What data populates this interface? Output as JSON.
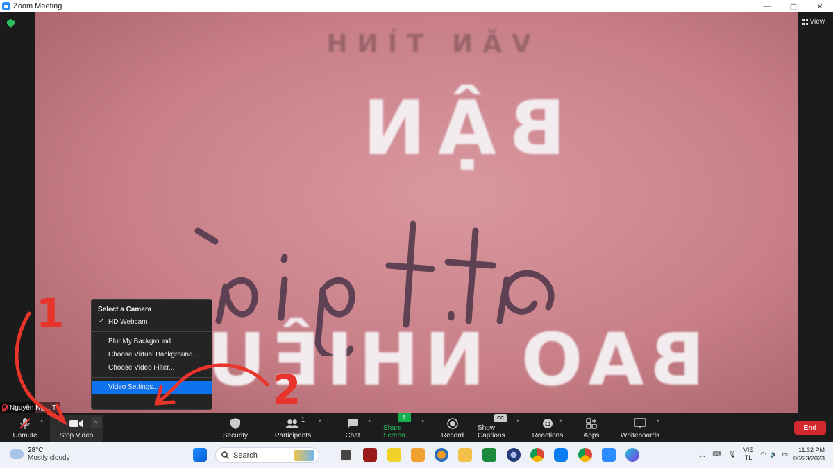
{
  "window": {
    "title": "Zoom Meeting",
    "controls": [
      "—",
      "▢",
      "✕"
    ]
  },
  "top_right": {
    "view_label": "View"
  },
  "video": {
    "top_text": "VĂN TÌNH",
    "line1": "BẬN",
    "script": "tất giá",
    "line3": "BAO NHIÊU"
  },
  "participant": {
    "name": "Nguyễn Ng... T"
  },
  "camera_menu": {
    "header": "Select a Camera",
    "camera": "HD Webcam",
    "options": [
      "Blur My Background",
      "Choose Virtual Background...",
      "Choose Video Filter..."
    ],
    "video_settings": "Video Settings..."
  },
  "annotations": {
    "step1": "1",
    "step2": "2",
    "arrow_color": "#e8342b"
  },
  "toolbar": {
    "unmute": "Unmute",
    "stop_video": "Stop Video",
    "security": "Security",
    "participants": "Participants",
    "participants_count": "1",
    "chat": "Chat",
    "share_screen": "Share Screen",
    "record": "Record",
    "show_captions": "Show Captions",
    "cc_badge": "CC",
    "reactions": "Reactions",
    "apps": "Apps",
    "whiteboards": "Whiteboards",
    "end": "End"
  },
  "taskbar": {
    "temperature": "28°C",
    "weather": "Mostly cloudy",
    "search_placeholder": "Search",
    "lang_line1": "VIE",
    "lang_line2": "TL",
    "time": "11:32 PM",
    "date": "06/23/2023"
  }
}
